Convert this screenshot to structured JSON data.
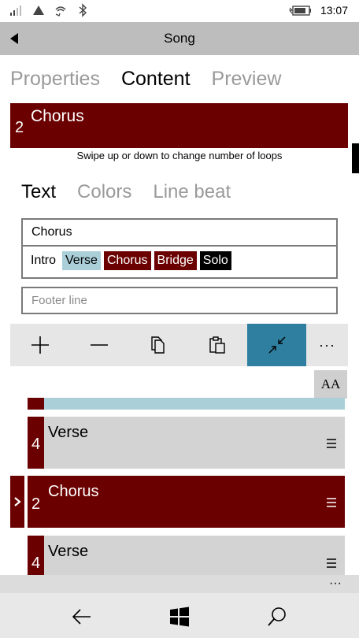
{
  "status": {
    "time": "13:07",
    "icons": [
      "signal-icon",
      "wifi-strength-icon",
      "wifi-call-icon",
      "bluetooth-icon",
      "battery-charging-icon"
    ]
  },
  "header": {
    "title": "Song"
  },
  "tabs": [
    {
      "label": "Properties",
      "active": false
    },
    {
      "label": "Content",
      "active": true
    },
    {
      "label": "Preview",
      "active": false
    }
  ],
  "loop": {
    "count": "2",
    "name": "Chorus",
    "hint": "Swipe up or down to change number of loops"
  },
  "subtabs": [
    {
      "label": "Text",
      "active": true
    },
    {
      "label": "Colors",
      "active": false
    },
    {
      "label": "Line beat",
      "active": false
    }
  ],
  "editor": {
    "text_value": "Chorus",
    "chips": [
      "Intro",
      "Verse",
      "Chorus",
      "Bridge",
      "Solo"
    ],
    "footer_placeholder": "Footer line"
  },
  "toolbar": {
    "buttons": [
      "add-icon",
      "remove-icon",
      "copy-icon",
      "paste-icon",
      "collapse-icon",
      "more-icon"
    ],
    "more_label": "···"
  },
  "font_button": "AA",
  "parts": [
    {
      "loops": "",
      "label": ""
    },
    {
      "loops": "4",
      "label": "Verse"
    },
    {
      "loops": "2",
      "label": "Chorus"
    },
    {
      "loops": "4",
      "label": "Verse"
    }
  ],
  "appbar": {
    "more_label": "···"
  },
  "colors": {
    "accent_dark_red": "#6b0000",
    "verse_blue": "#aacfd9",
    "active_tool": "#2e7fa0"
  }
}
